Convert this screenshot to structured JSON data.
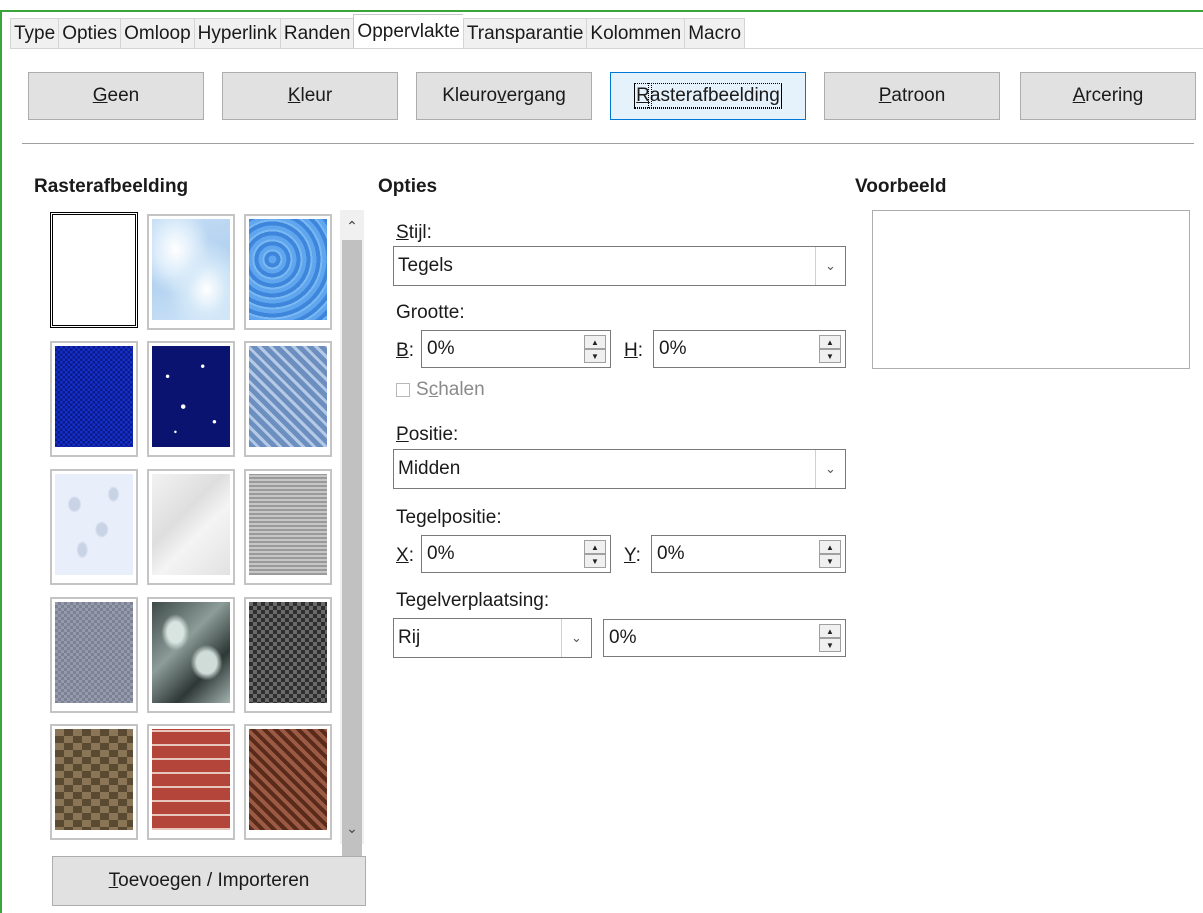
{
  "tabs": [
    "Type",
    "Opties",
    "Omloop",
    "Hyperlink",
    "Randen",
    "Oppervlakte",
    "Transparantie",
    "Kolommen",
    "Macro"
  ],
  "active_tab": "Oppervlakte",
  "fill_types": {
    "none": {
      "ul": "G",
      "rest": "een"
    },
    "color": {
      "ul": "K",
      "rest": "leur"
    },
    "gradient": {
      "pre": "Kleuro",
      "ul": "v",
      "rest": "ergang"
    },
    "bitmap": {
      "ul": "R",
      "rest": "asterafbeelding"
    },
    "pattern": {
      "ul": "P",
      "rest": "atroon"
    },
    "hatch": {
      "ul": "A",
      "rest": "rcering"
    }
  },
  "active_fill": "Rasterafbeelding",
  "bitmap_section": {
    "heading": "Rasterafbeelding",
    "import_button": {
      "ul": "T",
      "rest": "oevoegen / Importeren"
    }
  },
  "options": {
    "heading": "Opties",
    "style_label": {
      "ul": "S",
      "rest": "tijl:"
    },
    "style_value": "Tegels",
    "size_label": "Grootte:",
    "width_label": {
      "ul": "B",
      "rest": ":"
    },
    "width_value": "0%",
    "height_label": {
      "ul": "H",
      "rest": ":"
    },
    "height_value": "0%",
    "scale_label": {
      "pre": "S",
      "ul": "c",
      "rest": "halen"
    },
    "scale_checked": false,
    "position_label": {
      "ul": "P",
      "rest": "ositie:"
    },
    "position_value": "Midden",
    "tile_position_label": "Tegelpositie:",
    "x_label": {
      "ul": "X",
      "rest": ":"
    },
    "x_value": "0%",
    "y_label": {
      "ul": "Y",
      "rest": ":"
    },
    "y_value": "0%",
    "tile_offset_label": "Tegelverplaatsing:",
    "tile_offset_mode": "Rij",
    "tile_offset_value": "0%"
  },
  "preview": {
    "heading": "Voorbeeld"
  }
}
